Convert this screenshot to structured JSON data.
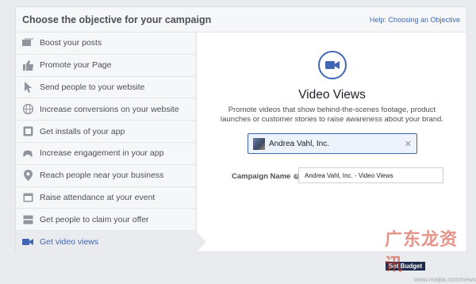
{
  "header": {
    "title": "Choose the objective for your campaign",
    "help_link": "Help: Choosing an Objective"
  },
  "sidebar": {
    "items": [
      {
        "label": "Boost your posts",
        "icon": "posts-icon"
      },
      {
        "label": "Promote your Page",
        "icon": "thumbs-up-icon"
      },
      {
        "label": "Send people to your website",
        "icon": "cursor-icon"
      },
      {
        "label": "Increase conversions on your website",
        "icon": "globe-icon"
      },
      {
        "label": "Get installs of your app",
        "icon": "app-box-icon"
      },
      {
        "label": "Increase engagement in your app",
        "icon": "gamepad-icon"
      },
      {
        "label": "Reach people near your business",
        "icon": "map-pin-icon"
      },
      {
        "label": "Raise attendance at your event",
        "icon": "calendar-icon"
      },
      {
        "label": "Get people to claim your offer",
        "icon": "offer-tag-icon"
      },
      {
        "label": "Get video views",
        "icon": "video-camera-icon",
        "active": true
      }
    ]
  },
  "main": {
    "objective_title": "Video Views",
    "objective_description": "Promote videos that show behind-the-scenes footage, product launches or customer stories to raise awareness about your brand.",
    "page_selector_value": "Andrea Vahl, Inc.",
    "campaign_name_label": "Campaign Name",
    "campaign_name_value": "Andrea Vahl, Inc. - Video Views"
  },
  "watermark": {
    "text": "广东龙资讯",
    "url": "www.maijia.com/news",
    "button_fragment": "Set Budget"
  },
  "colors": {
    "accent": "#4267b2",
    "sidebar_bg": "#f6f7f9",
    "active_bg": "#e9ebee"
  }
}
